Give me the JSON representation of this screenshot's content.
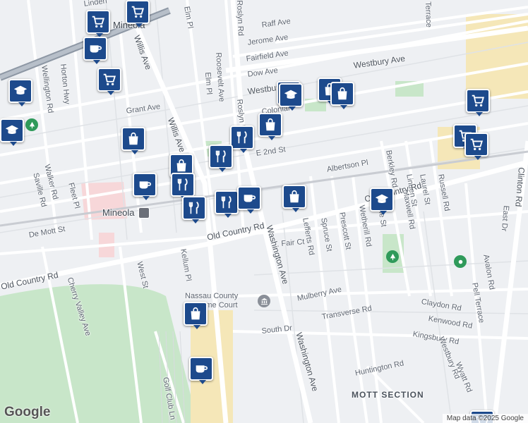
{
  "map": {
    "logo": "Google",
    "attribution": "Map data ©2025 Google",
    "colors": {
      "background": "#eef0f3",
      "road": "#ffffff",
      "park": "#c8e6c9",
      "highlight": "#f5e7b8",
      "hospital": "#f7d7d9",
      "pin": "#1d4a8c"
    }
  },
  "streets": {
    "elm_pl_top": "Elm Pl",
    "roslyn_rd": "Roslyn Rd",
    "raff_ave": "Raff Ave",
    "jerome_ave": "Jerome Ave",
    "fairfield_ave": "Fairfield Ave",
    "westbury_ave_1": "Westbury Ave",
    "westbury_ave_2": "Westbury Ave",
    "dow_ave": "Dow Ave",
    "willis_ave_1": "Willis Ave",
    "willis_ave_2": "Willis Ave",
    "wellington_rd": "Wellington Rd",
    "horton_hwy": "Horton Hwy",
    "grant_ave": "Grant Ave",
    "roosevelt_ave": "Roosevelt Ave",
    "elm_pl": "Elm Pl",
    "roslyn_rd_2": "Roslyn Rd",
    "colonial": "Colonial",
    "e_2nd_st": "E 2nd St",
    "albertson_pl": "Albertson Pl",
    "berkley_rd": "Berkley Rd",
    "maxwell_rd": "Maxwell Rd",
    "linden_st": "Linden St",
    "laurel_st": "Laurel St",
    "russell_rd": "Russell Rd",
    "clinton_rd": "Clinton Rd",
    "east_dr": "East Dr",
    "old_country_rd_1": "Old Country Rd",
    "old_country_rd_2": "Old Country Rd",
    "old_country_rd_3": "Old Country Rd",
    "maple_st": "Maple St",
    "wetherill_rd": "Wetherill Rd",
    "prescott_st": "Prescott St",
    "spruce_st": "Spruce St",
    "lefferts_rd": "Lefferts Rd",
    "fair_ct": "Fair Ct",
    "washington_ave_1": "Washington Ave",
    "washington_ave_2": "Washington Ave",
    "de_mott_st": "De Mott St",
    "walker_rd": "Walker Rd",
    "saville_rd": "Saville Rd",
    "fleet_pl": "Fleet Pl",
    "west_st": "West St",
    "kellum_pl": "Kellum Pl",
    "cherry_valley_ave": "Cherry Valley Ave",
    "mulberry_ave": "Mulberry Ave",
    "claydon_rd": "Claydon Rd",
    "kenwood_rd": "Kenwood Rd",
    "kingsbury_rd": "Kingsbury Rd",
    "transverse_rd": "Transverse Rd",
    "south_dr": "South Dr",
    "avalon_rd": "Avalon Rd",
    "pell_terrace": "Pell Terrace",
    "westbury_rd": "Westbury Rd",
    "wyatt_rd": "Wyatt Rd",
    "huntington_rd": "Huntington Rd",
    "golf_club_ln": "Golf Club Ln",
    "linden_top": "Linden",
    "terrace_top": "Terrace"
  },
  "places": {
    "mineola_city": "Mineola",
    "mineola_station": "Mineola",
    "court": "Nassau County Supreme Court",
    "mott_section": "MOTT SECTION"
  },
  "pins": [
    {
      "kind": "cart",
      "icon": "cart-icon"
    },
    {
      "kind": "cart",
      "icon": "cart-icon"
    },
    {
      "kind": "coffee",
      "icon": "coffee-icon"
    },
    {
      "kind": "cart",
      "icon": "cart-icon"
    },
    {
      "kind": "school",
      "icon": "school-icon"
    },
    {
      "kind": "school",
      "icon": "school-icon"
    },
    {
      "kind": "school",
      "icon": "school-icon"
    },
    {
      "kind": "bag",
      "icon": "shopping-bag-icon"
    },
    {
      "kind": "bag",
      "icon": "shopping-bag-icon"
    },
    {
      "kind": "school",
      "icon": "school-icon"
    },
    {
      "kind": "bag",
      "icon": "shopping-bag-icon"
    },
    {
      "kind": "food",
      "icon": "restaurant-icon"
    },
    {
      "kind": "food",
      "icon": "restaurant-icon"
    },
    {
      "kind": "bag",
      "icon": "shopping-bag-icon"
    },
    {
      "kind": "bag",
      "icon": "shopping-bag-icon"
    },
    {
      "kind": "coffee",
      "icon": "coffee-icon"
    },
    {
      "kind": "food",
      "icon": "restaurant-icon"
    },
    {
      "kind": "food",
      "icon": "restaurant-icon"
    },
    {
      "kind": "food",
      "icon": "restaurant-icon"
    },
    {
      "kind": "coffee",
      "icon": "coffee-icon"
    },
    {
      "kind": "bag",
      "icon": "shopping-bag-icon"
    },
    {
      "kind": "cart",
      "icon": "cart-icon"
    },
    {
      "kind": "school",
      "icon": "school-icon"
    },
    {
      "kind": "cart",
      "icon": "cart-icon"
    },
    {
      "kind": "cart",
      "icon": "cart-icon"
    },
    {
      "kind": "bag",
      "icon": "shopping-bag-icon"
    },
    {
      "kind": "coffee",
      "icon": "coffee-icon"
    },
    {
      "kind": "cart",
      "icon": "cart-icon"
    }
  ]
}
